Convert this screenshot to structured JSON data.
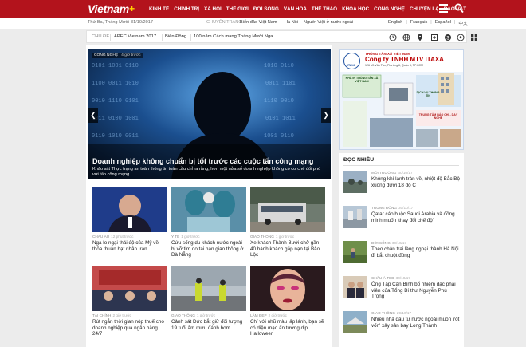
{
  "header": {
    "logo": "Vietnam",
    "logo_plus": "+",
    "nav": [
      "KINH TẾ",
      "CHÍNH TRỊ",
      "XÃ HỘI",
      "THẾ GIỚI",
      "ĐỜI SỐNG",
      "VĂN HÓA",
      "THỂ THAO",
      "KHOA HỌC",
      "CÔNG NGHỆ",
      "CHUYỆN LẠ",
      "RAO VẶT"
    ],
    "menu_icon": "hamburger-icon",
    "search_icon": "search-icon",
    "colors": {
      "bar": "#b3131c"
    }
  },
  "info": {
    "date": "Thứ Ba, Tháng Mười 31/10/2017",
    "featured_label": "CHUYÊN TRANG",
    "featured_links": [
      "Biển đảo Việt Nam",
      "Hà Nội",
      "Người Việt ở nước ngoài"
    ],
    "languages": [
      "English",
      "Français",
      "Español",
      "中文"
    ]
  },
  "topics": {
    "label": "CHỦ ĐỀ",
    "items": [
      "APEC Vietnam 2017",
      "Biển Đông",
      "100 năm Cách mạng Tháng Mười Nga"
    ],
    "icons": [
      "clock-icon",
      "globe-icon",
      "location-pin-icon",
      "hospital-icon",
      "coin-icon",
      "soccer-ball-icon",
      "grid-icon"
    ]
  },
  "hero": {
    "category": "CÔNG NGHỆ",
    "time": "4 giờ trước",
    "title": "Doanh nghiệp không chuẩn bị tốt trước các cuộc tấn công mạng",
    "description": "Khảo sát Thực trạng an toàn thông tin toàn cầu chỉ ra rằng, hơn một nửa số doanh nghiệp không có cơ chế đối phó với tấn công mạng",
    "prev_icon": "chevron-left-icon",
    "next_icon": "chevron-right-icon"
  },
  "cards": [
    {
      "category": "CHÂU ÂU",
      "time": "12 phút trước",
      "title": "Nga lo ngại thái độ của Mỹ về thỏa thuận hạt nhân Iran"
    },
    {
      "category": "Y TẾ",
      "time": "1 giờ trước",
      "title": "Cứu sống du khách nước ngoài bị vỡ tim do tai nạn giao thông ở Đà Nẵng"
    },
    {
      "category": "GIAO THÔNG",
      "time": "1 giờ trước",
      "title": "Xe khách Thành Bưởi chở gần 40 hành khách gặp nạn tại Bảo Lộc"
    },
    {
      "category": "TÀI CHÍNH",
      "time": "2 giờ trước",
      "title": "Rút ngắn thời gian nộp thuế cho doanh nghiệp qua ngân hàng 24/7"
    },
    {
      "category": "GIAO THÔNG",
      "time": "1 giờ trước",
      "title": "Cảnh sát Đức bắt giữ đối tượng 19 tuổi âm mưu đánh bom"
    },
    {
      "category": "LÀM ĐẸP",
      "time": "2 giờ trước",
      "title": "Chỉ với nhũ màu lấp lánh, bạn sẽ có diện mạo ấn tượng dịp Halloween"
    }
  ],
  "ad": {
    "top_line": "THÔNG TẤN XÃ VIỆT NAM",
    "company": "Công ty TNHH MTV ITAXA",
    "address": "126 Võ Văn Tần, Phường 6, Quận 3, TP.HCM",
    "logo_text": "ITAXA",
    "blocks": [
      "NHÀ IN THÔNG TẤN XÃ VIỆT NAM",
      "DỊCH VỤ THÔNG TIN",
      "TRUNG TÂM BÁO CHÍ - DẠY NGHỀ"
    ]
  },
  "sidebar": {
    "heading": "ĐỌC NHIỀU",
    "items": [
      {
        "category": "MÔI TRƯỜNG",
        "time": "30/10/17",
        "title": "Không khí lạnh tràn về, nhiệt độ Bắc Bộ xuống dưới 18 độ C"
      },
      {
        "category": "TRUNG ĐÔNG",
        "time": "30/10/17",
        "title": "Qatar cáo buộc Saudi Arabia và đồng minh muốn 'thay đổi chế độ'"
      },
      {
        "category": "ĐỜI SỐNG",
        "time": "30/10/17",
        "title": "Theo chân trai làng ngoại thành Hà Nội đi bắt chuột đồng"
      },
      {
        "category": "CHÂU Á-TBD",
        "time": "30/10/17",
        "title": "Ông Tập Cận Bình bổ nhiệm đặc phái viên của Tổng Bí thư Nguyễn Phú Trọng"
      },
      {
        "category": "GIAO THÔNG",
        "time": "29/10/17",
        "title": "Nhiều nhà đầu tư nước ngoài muốn 'rót vốn' xây sân bay Long Thành"
      }
    ]
  }
}
